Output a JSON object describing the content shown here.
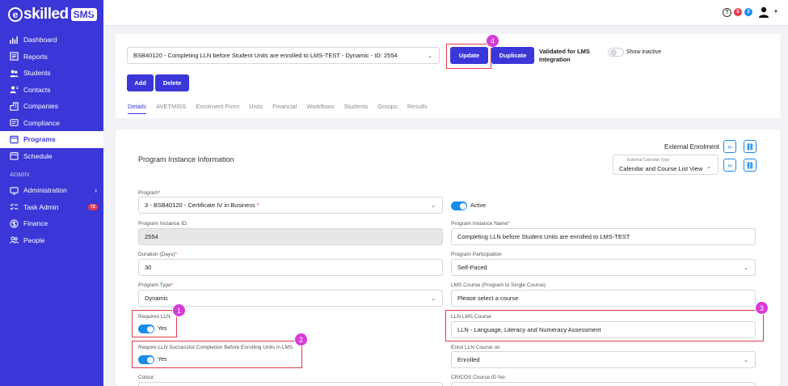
{
  "brand": {
    "logo_text": "skilled",
    "logo_badge": "SMS",
    "collapse": "«"
  },
  "sidebar": {
    "items": [
      {
        "label": "Dashboard"
      },
      {
        "label": "Reports"
      },
      {
        "label": "Students"
      },
      {
        "label": "Contacts"
      },
      {
        "label": "Companies"
      },
      {
        "label": "Compliance"
      },
      {
        "label": "Programs"
      },
      {
        "label": "Schedule"
      }
    ],
    "admin_label": "ADMIN",
    "admin_items": [
      {
        "label": "Administration"
      },
      {
        "label": "Task Admin",
        "badge": "72"
      },
      {
        "label": "Finance"
      },
      {
        "label": "People"
      }
    ]
  },
  "topbar": {
    "help": "?",
    "badge_red": "5",
    "badge_blue": "2"
  },
  "program_bar": {
    "selected": "BSB40120 - Completing LLN before Student Units are enrolled to LMS-TEST - Dynamic - ID: 2554",
    "update_label": "Update",
    "duplicate_label": "Duplicate",
    "validated_line1": "Validated for LMS",
    "validated_line2": "Integration",
    "show_inactive": "Show inactive",
    "add_label": "Add",
    "delete_label": "Delete"
  },
  "tabs": [
    "Details",
    "AVETMISS",
    "Enrolment Form",
    "Units",
    "Financial",
    "Workflows",
    "Students",
    "Groups",
    "Results"
  ],
  "section": {
    "title": "Program Instance Information",
    "external_enrolment": "External Enrolment",
    "calendar_type_label": "External Calendar Type",
    "calendar_type_value": "Calendar and Course List View"
  },
  "form": {
    "program_label": "Program",
    "program_value": "3 - BSB40120 - Certificate IV in Business",
    "active_label": "Active",
    "instance_id_label": "Program Instance ID:",
    "instance_id_value": "2554",
    "instance_name_label": "Program Instance Name",
    "instance_name_value": "Completing LLN before Student Units are enrolled to LMS-TEST",
    "duration_label": "Duration (Days)",
    "duration_value": "30",
    "participation_label": "Program Participation",
    "participation_value": "Self-Paced",
    "type_label": "Program Type",
    "type_value": "Dynamic",
    "lms_course_label": "LMS Course (Program to Single Course)",
    "lms_course_value": "Please select a course",
    "requires_lln_label": "Requires LLN",
    "requires_lln_value": "Yes",
    "lln_lms_label": "LLN LMS Course",
    "lln_lms_value": "LLN - Language, Literacy and Numeracy Assessment",
    "require_lln_success_label": "Require LLN Successful Completion Before Enrolling Units in LMS",
    "require_lln_success_value": "Yes",
    "enrol_lln_label": "Enrol LLN Course on",
    "enrol_lln_value": "Enrolled",
    "colour_label": "Colour:",
    "cricos_label": "CRICOS Course ID No:"
  },
  "callouts": [
    "1",
    "2",
    "3",
    "4"
  ],
  "colors": {
    "primary": "#3a36d8",
    "highlight": "#e53a4b",
    "callout": "#d63ad8",
    "toggle": "#1a8ce8"
  }
}
